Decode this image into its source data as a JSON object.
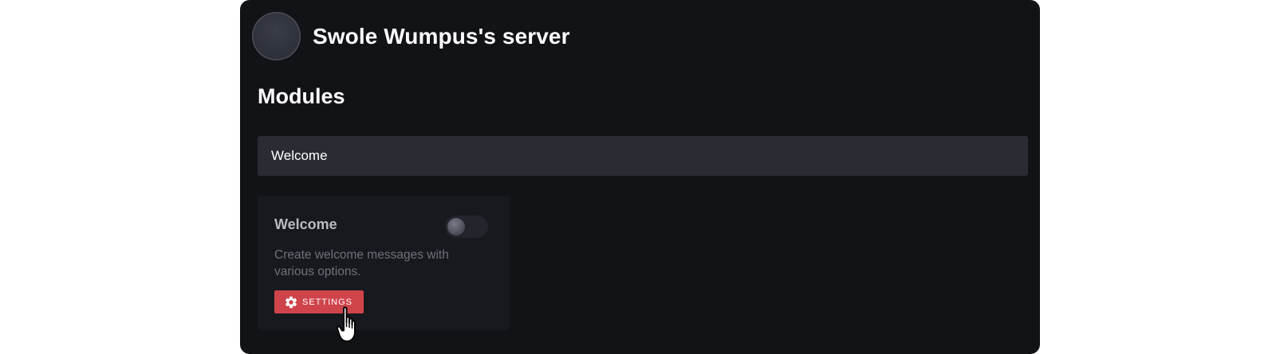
{
  "server": {
    "name": "Swole Wumpus's server"
  },
  "modules_section": {
    "title": "Modules",
    "search_value": "Welcome"
  },
  "module_card": {
    "title": "Welcome",
    "description": "Create welcome messages with various options.",
    "enabled": false,
    "settings_label": "SETTINGS",
    "settings_icon": "gear-icon"
  },
  "colors": {
    "background": "#121317",
    "search_background": "#2a2c34",
    "card_background": "#18191e",
    "accent": "#cf444b",
    "title_text": "#ffffff",
    "card_title_text": "#b9bbc2",
    "description_text": "#6e717b"
  },
  "cursor": "hand-pointer-icon"
}
